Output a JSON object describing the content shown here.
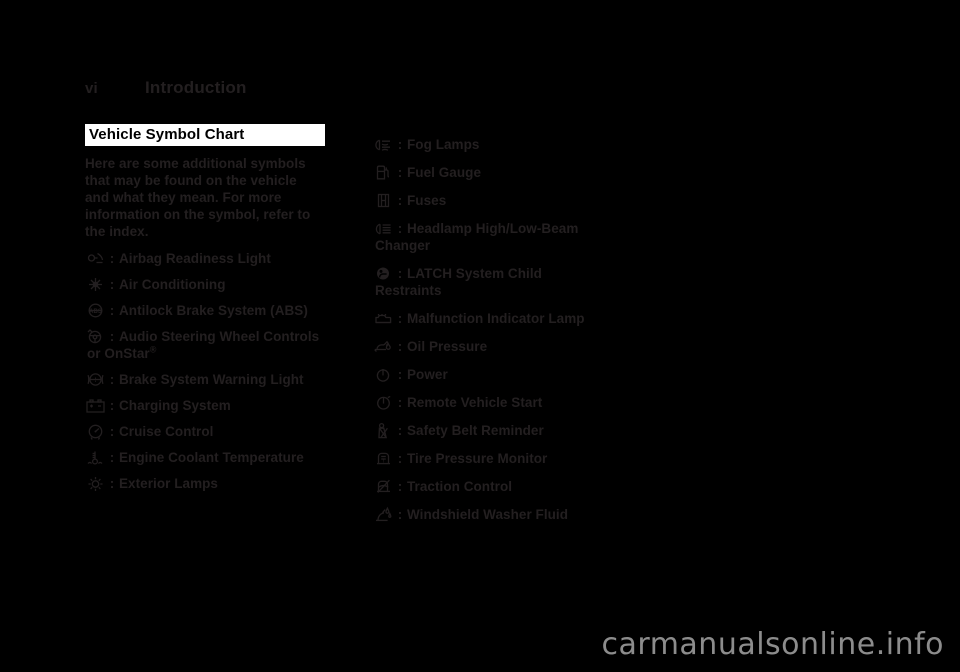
{
  "header": {
    "folio": "vi",
    "chapter": "Introduction"
  },
  "section": {
    "title": "Vehicle Symbol Chart",
    "intro": "Here are some additional symbols that may be found on the vehicle and what they mean. For more information on the symbol, refer to the index."
  },
  "colors": {
    "page_background": "#000000",
    "text": "#231f20",
    "title_bar_background": "#ffffff",
    "title_bar_text": "#000000",
    "watermark": "#8c8c8c"
  },
  "separator": ":",
  "left_column": [
    {
      "icon": "airbag-readiness-icon",
      "label": "Airbag Readiness Light"
    },
    {
      "icon": "air-conditioning-icon",
      "label": "Air Conditioning"
    },
    {
      "icon": "antilock-brake-icon",
      "label": "Antilock Brake System (ABS)"
    },
    {
      "icon": "audio-steering-wheel-controls-icon",
      "label": "Audio Steering Wheel Controls",
      "label_cont": "or OnStar®"
    },
    {
      "icon": "brake-system-warning-icon",
      "label": "Brake System Warning Light"
    },
    {
      "icon": "charging-system-icon",
      "label": "Charging System"
    },
    {
      "icon": "cruise-control-icon",
      "label": "Cruise Control"
    },
    {
      "icon": "engine-coolant-temperature-icon",
      "label": "Engine Coolant Temperature"
    },
    {
      "icon": "exterior-lamps-icon",
      "label": "Exterior Lamps"
    }
  ],
  "right_column": [
    {
      "icon": "fog-lamps-icon",
      "label": "Fog Lamps"
    },
    {
      "icon": "fuel-gauge-icon",
      "label": "Fuel Gauge"
    },
    {
      "icon": "fuses-icon",
      "label": "Fuses"
    },
    {
      "icon": "headlamp-high-low-beam-icon",
      "label": "Headlamp High/Low-Beam",
      "label_cont": "Changer"
    },
    {
      "icon": "latch-child-restraint-icon",
      "label": "LATCH System Child",
      "label_cont": "Restraints"
    },
    {
      "icon": "malfunction-indicator-lamp-icon",
      "label": "Malfunction Indicator Lamp"
    },
    {
      "icon": "oil-pressure-icon",
      "label": "Oil Pressure"
    },
    {
      "icon": "power-icon",
      "label": "Power"
    },
    {
      "icon": "remote-vehicle-start-icon",
      "label": "Remote Vehicle Start"
    },
    {
      "icon": "safety-belt-reminder-icon",
      "label": "Safety Belt Reminder"
    },
    {
      "icon": "tire-pressure-monitor-icon",
      "label": "Tire Pressure Monitor"
    },
    {
      "icon": "traction-control-icon",
      "label": "Traction Control"
    },
    {
      "icon": "windshield-washer-fluid-icon",
      "label": "Windshield Washer Fluid"
    }
  ],
  "footer": {
    "watermark": "carmanualsonline.info"
  }
}
